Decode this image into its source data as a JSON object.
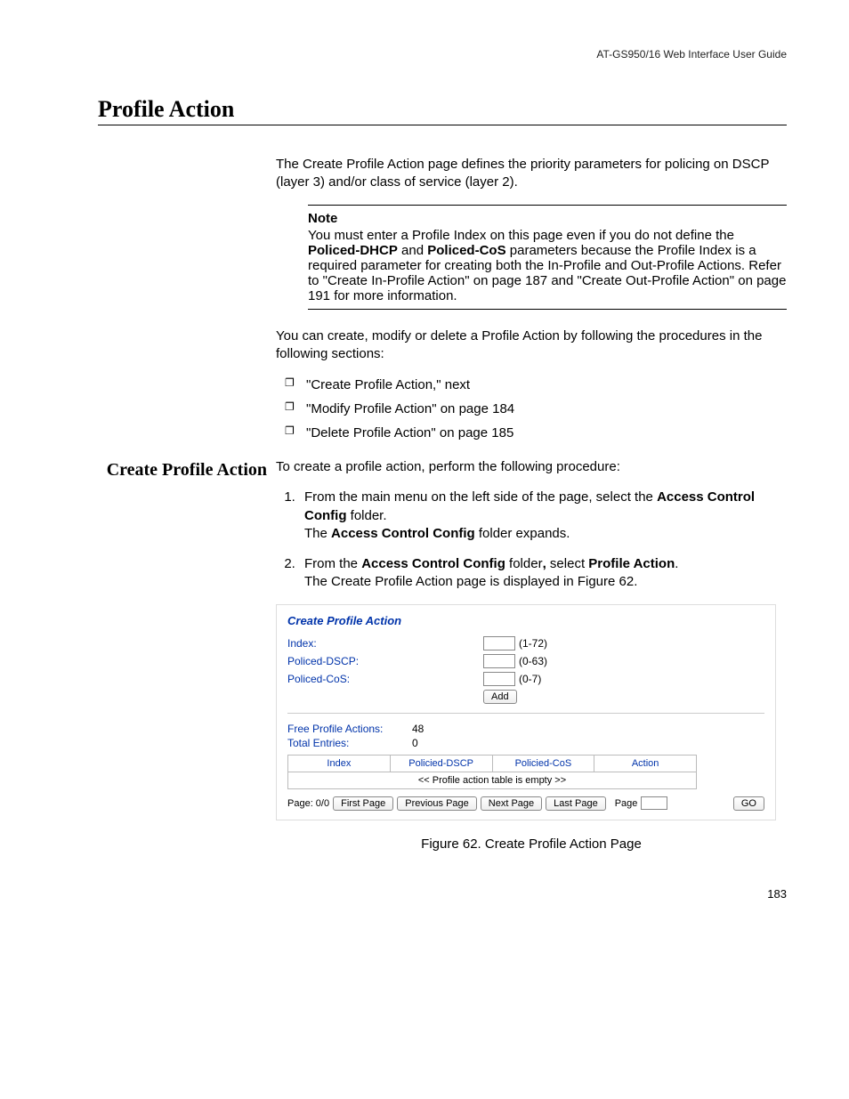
{
  "header": {
    "guide": "AT-GS950/16  Web Interface User Guide"
  },
  "h1": "Profile Action",
  "intro": "The Create Profile Action page defines the priority parameters for policing on DSCP (layer 3) and/or class of service (layer 2).",
  "note": {
    "title": "Note",
    "pre": "You must enter a Profile Index on this page even if you do not define the ",
    "b1": "Policed-DHCP",
    "mid": " and ",
    "b2": "Policed-CoS",
    "post": " parameters because the Profile Index is a required parameter for creating both the In-Profile and Out-Profile Actions. Refer to \"Create In-Profile Action\" on page 187 and \"Create Out-Profile Action\" on page 191 for more information."
  },
  "lead2": "You can create, modify or delete a Profile Action by following the procedures in the following sections:",
  "bullets": {
    "b1": "\"Create Profile Action,\"  next",
    "b2": "\"Modify Profile Action\" on page 184",
    "b3": "\"Delete Profile Action\" on page 185"
  },
  "sub": "Create Profile Action",
  "procIntro": "To create a profile action, perform the following procedure:",
  "step1": {
    "a": "From the main menu on the left side of the page, select the ",
    "b1": "Access Control Config",
    "c": " folder.",
    "d": "The ",
    "b2": "Access Control Config",
    "e": " folder expands."
  },
  "step2": {
    "a": "From the ",
    "b1": "Access Control Config",
    "b": " folder",
    "comma": ", ",
    "c": "select ",
    "b2": "Profile Action",
    "d": ".",
    "e": "The Create Profile Action page is displayed in Figure 62."
  },
  "panel": {
    "title": "Create Profile Action",
    "rows": {
      "index": {
        "label": "Index:",
        "range": "(1-72)"
      },
      "dscp": {
        "label": "Policed-DSCP:",
        "range": "(0-63)"
      },
      "cos": {
        "label": "Policed-CoS:",
        "range": "(0-7)"
      }
    },
    "addBtn": "Add",
    "stats": {
      "free": {
        "label": "Free Profile Actions:",
        "value": "48"
      },
      "total": {
        "label": "Total Entries:",
        "value": "0"
      }
    },
    "table": {
      "h1": "Index",
      "h2": "Policied-DSCP",
      "h3": "Policied-CoS",
      "h4": "Action",
      "empty": "<< Profile action table is empty >>"
    },
    "pager": {
      "page": "Page: 0/0",
      "first": "First Page",
      "prev": "Previous Page",
      "next": "Next Page",
      "last": "Last Page",
      "pageLbl": "Page",
      "go": "GO"
    }
  },
  "figCaption": "Figure 62. Create Profile Action Page",
  "pageNumber": "183"
}
